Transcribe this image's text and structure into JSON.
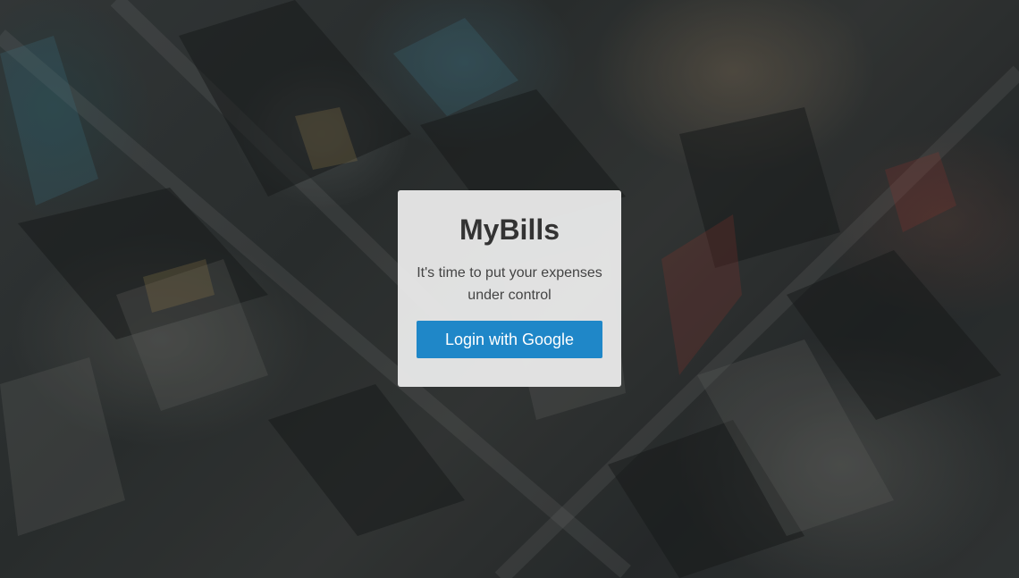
{
  "app": {
    "title": "MyBills",
    "tagline": "It's time to put your expenses under control"
  },
  "login": {
    "button_label": "Login with Google"
  },
  "colors": {
    "button_background": "#1f87c8",
    "card_background": "#ececec",
    "title_text": "#333333"
  },
  "background": {
    "image": "aerial-city-view"
  }
}
